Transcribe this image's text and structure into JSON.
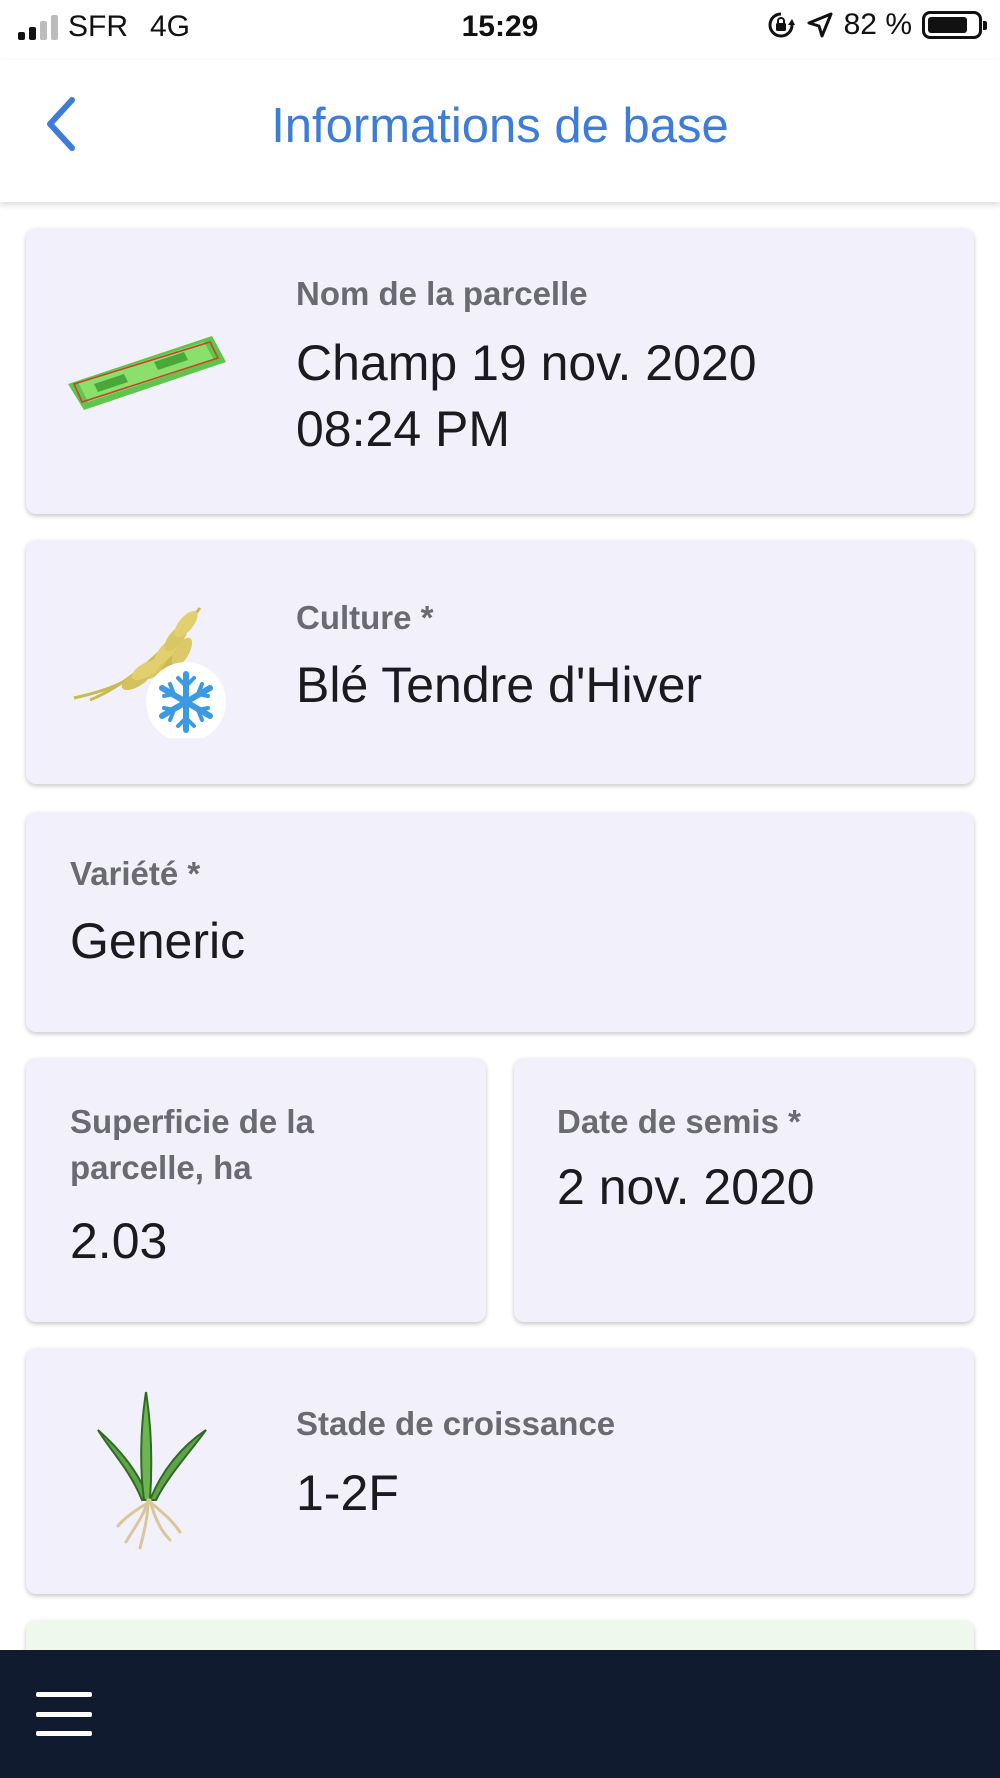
{
  "status_bar": {
    "carrier": "SFR",
    "network": "4G",
    "time": "15:29",
    "battery": "82 %",
    "battery_level": 0.82
  },
  "header": {
    "title": "Informations de base",
    "back_icon": "chevron-left-icon"
  },
  "cards": {
    "parcel_name": {
      "label": "Nom de la parcelle",
      "value_line1": "Champ 19 nov. 2020",
      "value_line2": "08:24 PM",
      "icon": "field-map-icon"
    },
    "crop": {
      "label": "Culture *",
      "value": "Blé Tendre d'Hiver",
      "icon": "winter-wheat-icon"
    },
    "variety": {
      "label": "Variété *",
      "value": "Generic"
    },
    "area": {
      "label_line1": "Superficie de la",
      "label_line2": "parcelle, ha",
      "value": "2.03"
    },
    "sowing_date": {
      "label": "Date de semis *",
      "value": "2 nov. 2020"
    },
    "growth_stage": {
      "label": "Stade de croissance",
      "value": "1-2F",
      "icon": "seedling-icon"
    }
  },
  "bottom_bar": {
    "menu_icon": "hamburger-menu-icon"
  },
  "colors": {
    "accent": "#3d7cd8",
    "card_background": "#f2f1fb",
    "label": "#6a6a72",
    "bottom_bar": "#111b2f"
  }
}
